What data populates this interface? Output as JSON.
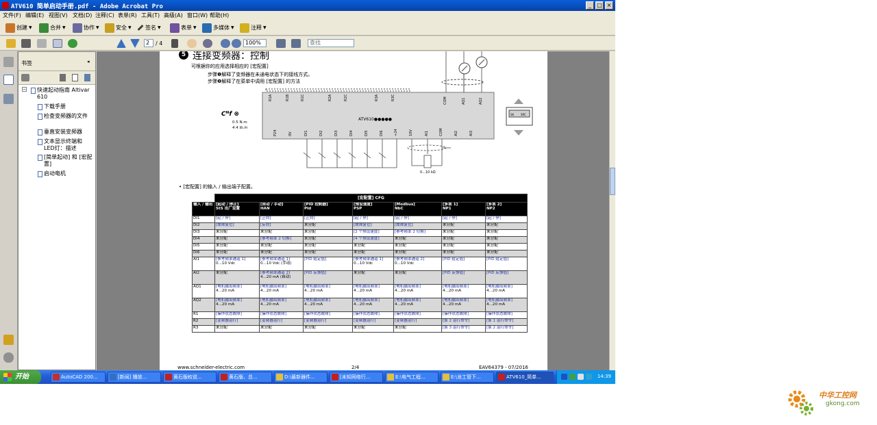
{
  "window": {
    "title": "ATV610 简单启动手册.pdf - Adobe Acrobat Pro",
    "min": "_",
    "max": "□",
    "close": "×"
  },
  "menu": [
    "文件(F)",
    "编辑(E)",
    "视图(V)",
    "文档(D)",
    "注释(C)",
    "表单(R)",
    "工具(T)",
    "高级(A)",
    "窗口(W)",
    "帮助(H)"
  ],
  "toolbar1": [
    {
      "label": "创建",
      "icon": "create-icon",
      "color": "#c9762c"
    },
    {
      "label": "合并",
      "icon": "combine-icon",
      "color": "#3a8a3a"
    },
    {
      "label": "协作",
      "icon": "collaborate-icon",
      "color": "#6a6aa0"
    },
    {
      "label": "安全",
      "icon": "lock-icon",
      "color": "#c8a020"
    },
    {
      "label": "签名",
      "icon": "pen-icon",
      "color": "#404040"
    },
    {
      "label": "表单",
      "icon": "form-icon",
      "color": "#7050a0"
    },
    {
      "label": "多媒体",
      "icon": "multimedia-icon",
      "color": "#2a6ab0"
    },
    {
      "label": "注释",
      "icon": "comment-icon",
      "color": "#d0b020"
    }
  ],
  "toolbar2": {
    "page_current": "2",
    "page_total": "/ 4",
    "zoom": "100%",
    "find_placeholder": "查找"
  },
  "bookmarks": {
    "title": "书签",
    "items": [
      "快速起动指南 Altivar 610",
      "下载手册",
      "检查变频器的文件",
      "垂直安装变频器",
      "文本显示终端和 LED灯：描述",
      "[简单起动] 和 [宏配置]",
      "启动电机"
    ]
  },
  "page": {
    "step_number": "5",
    "heading": "连接变频器：控制",
    "intro": "可根据你的应用选择相应的 [宏配置]",
    "bullet1": "步骤❶解释了变频器在未通电状态下的接线方式。",
    "bullet2": "步骤❷解释了在菜单中调用 [宏配置] 的方法",
    "torque1": "0.5 N.m",
    "torque2": "4.4 lb.in",
    "drive_label": "ATV610●●●●●",
    "terminals_top": [
      "R1A",
      "R1B",
      "R1C",
      "R2A",
      "R2C",
      "R3A",
      "R3C",
      "COM",
      "AQ1",
      "AQ2"
    ],
    "terminals_bottom": [
      "P24",
      "0V",
      "DI1",
      "DI2",
      "DI3",
      "DI4",
      "DI5",
      "DI6",
      "+24",
      "10V",
      "AI1",
      "COM",
      "AI2",
      "AI3"
    ],
    "pot_label": "0...10 kΩ",
    "switch_labels": [
      "SK",
      "SRC"
    ],
    "table_intro": "[宏配置] 的输入 / 输出端子配置。",
    "footer_left": "www.schneider-electric.com",
    "footer_mid": "2/4",
    "footer_right": "EAV64379 - 07/2016"
  },
  "io_table": {
    "title": "[宏配置] CFG",
    "headers": [
      [
        "输入 / 输出",
        ""
      ],
      [
        "[起动 / 停止]",
        "StS 出厂设置"
      ],
      [
        "[自动 / 手动]",
        "HAN"
      ],
      [
        "[PID 控制器]",
        "PId"
      ],
      [
        "[预设速度]",
        "PSP"
      ],
      [
        "[Modbus]",
        "NbC"
      ],
      [
        "[多泵 1]",
        "NP1"
      ],
      [
        "[多泵 2]",
        "NP2"
      ]
    ],
    "rows": [
      [
        "DI1",
        "[起 / 停]",
        "[正向]",
        "[正向]",
        "[起 / 停]",
        "[起 / 停]",
        "[起 / 停]",
        "[起 / 停]"
      ],
      [
        "DI2",
        "[故障复位]",
        "[反向]",
        "未分配",
        "[故障复位]",
        "[故障复位]",
        "未分配",
        "未分配"
      ],
      [
        "DI3",
        "未分配",
        "未分配",
        "未分配",
        "[2 个预设速度]",
        "[参考频率 2 切换]",
        "未分配",
        "未分配"
      ],
      [
        "DI4",
        "未分配",
        "[参考频率 2 切换]",
        "未分配",
        "[4 个预设速度]",
        "未分配",
        "未分配",
        "未分配"
      ],
      [
        "DI5",
        "未分配",
        "未分配",
        "未分配",
        "未分配",
        "未分配",
        "未分配",
        "未分配"
      ],
      [
        "DI6",
        "未分配",
        "未分配",
        "未分配",
        "未分配",
        "未分配",
        "未分配",
        "未分配"
      ],
      [
        "AI1",
        "[参考频率通道 1]|0...10 Vdc",
        "[参考频率通道 1]|0...10 Vdc (手动)",
        "[PID 给定值]",
        "[参考频率通道 1]|0...10 Vdc",
        "[参考频率通道 2]|0...10 Vdc",
        "[PID 给定值]",
        "[PID 给定值]"
      ],
      [
        "AI2",
        "未分配",
        "[参考频率通道 2]|4...20 mA (自动)",
        "[PID 反馈值]",
        "未分配",
        "未分配",
        "[PID 反馈值]",
        "[PID 反馈值]"
      ],
      [
        "AQ1",
        "[电机输出频率]|4...20 mA",
        "[电机输出频率]|4...20 mA",
        "[电机输出频率]|4...20 mA",
        "[电机输出频率]|4...20 mA",
        "[电机输出频率]|4...20 mA",
        "[电机输出频率]|4...20 mA",
        "[电机输出频率]|4...20 mA"
      ],
      [
        "AQ2",
        "[电机输出频率]|4...20 mA",
        "[电机输出频率]|4...20 mA",
        "[电机输出频率]|4...20 mA",
        "[电机输出频率]|4...20 mA",
        "[电机输出频率]|4...20 mA",
        "[电机输出频率]|4...20 mA",
        "[电机输出频率]|4...20 mA"
      ],
      [
        "R1",
        "[操作状态故障]",
        "[操作状态故障]",
        "[操作状态故障]",
        "[操作状态故障]",
        "[操作状态故障]",
        "[操作状态故障]",
        "[操作状态故障]"
      ],
      [
        "R2",
        "[变频器运行]",
        "[变频器运行]",
        "[变频器运行]",
        "[变频器运行]",
        "[变频器运行]",
        "[泵 2 运行命令]",
        "[泵 1 运行命令]"
      ],
      [
        "R3",
        "未分配",
        "未分配",
        "未分配",
        "未分配",
        "未分配",
        "[泵 3 运行命令]",
        "[泵 2 运行命令]"
      ]
    ]
  },
  "taskbar": {
    "start": "开始",
    "tasks": [
      {
        "label": "AutoCAD 200...",
        "color": "#c03030"
      },
      {
        "label": "[新闻] 播放...",
        "color": "#3070c0"
      },
      {
        "label": "黄石版权说...",
        "color": "#c02020"
      },
      {
        "label": "黄石版、总...",
        "color": "#c02020"
      },
      {
        "label": "D:\\最新器件...",
        "color": "#e0c040"
      },
      {
        "label": "[未知网络行...",
        "color": "#c02020"
      },
      {
        "label": "E:\\电气工程...",
        "color": "#e0c040"
      },
      {
        "label": "E:\\龙工管下...",
        "color": "#e0c040"
      },
      {
        "label": "ATV610_简单...",
        "color": "#c02020"
      }
    ],
    "clock": "14:39"
  },
  "watermark": {
    "cn": "中华工控网",
    "url": "gkong.com"
  }
}
